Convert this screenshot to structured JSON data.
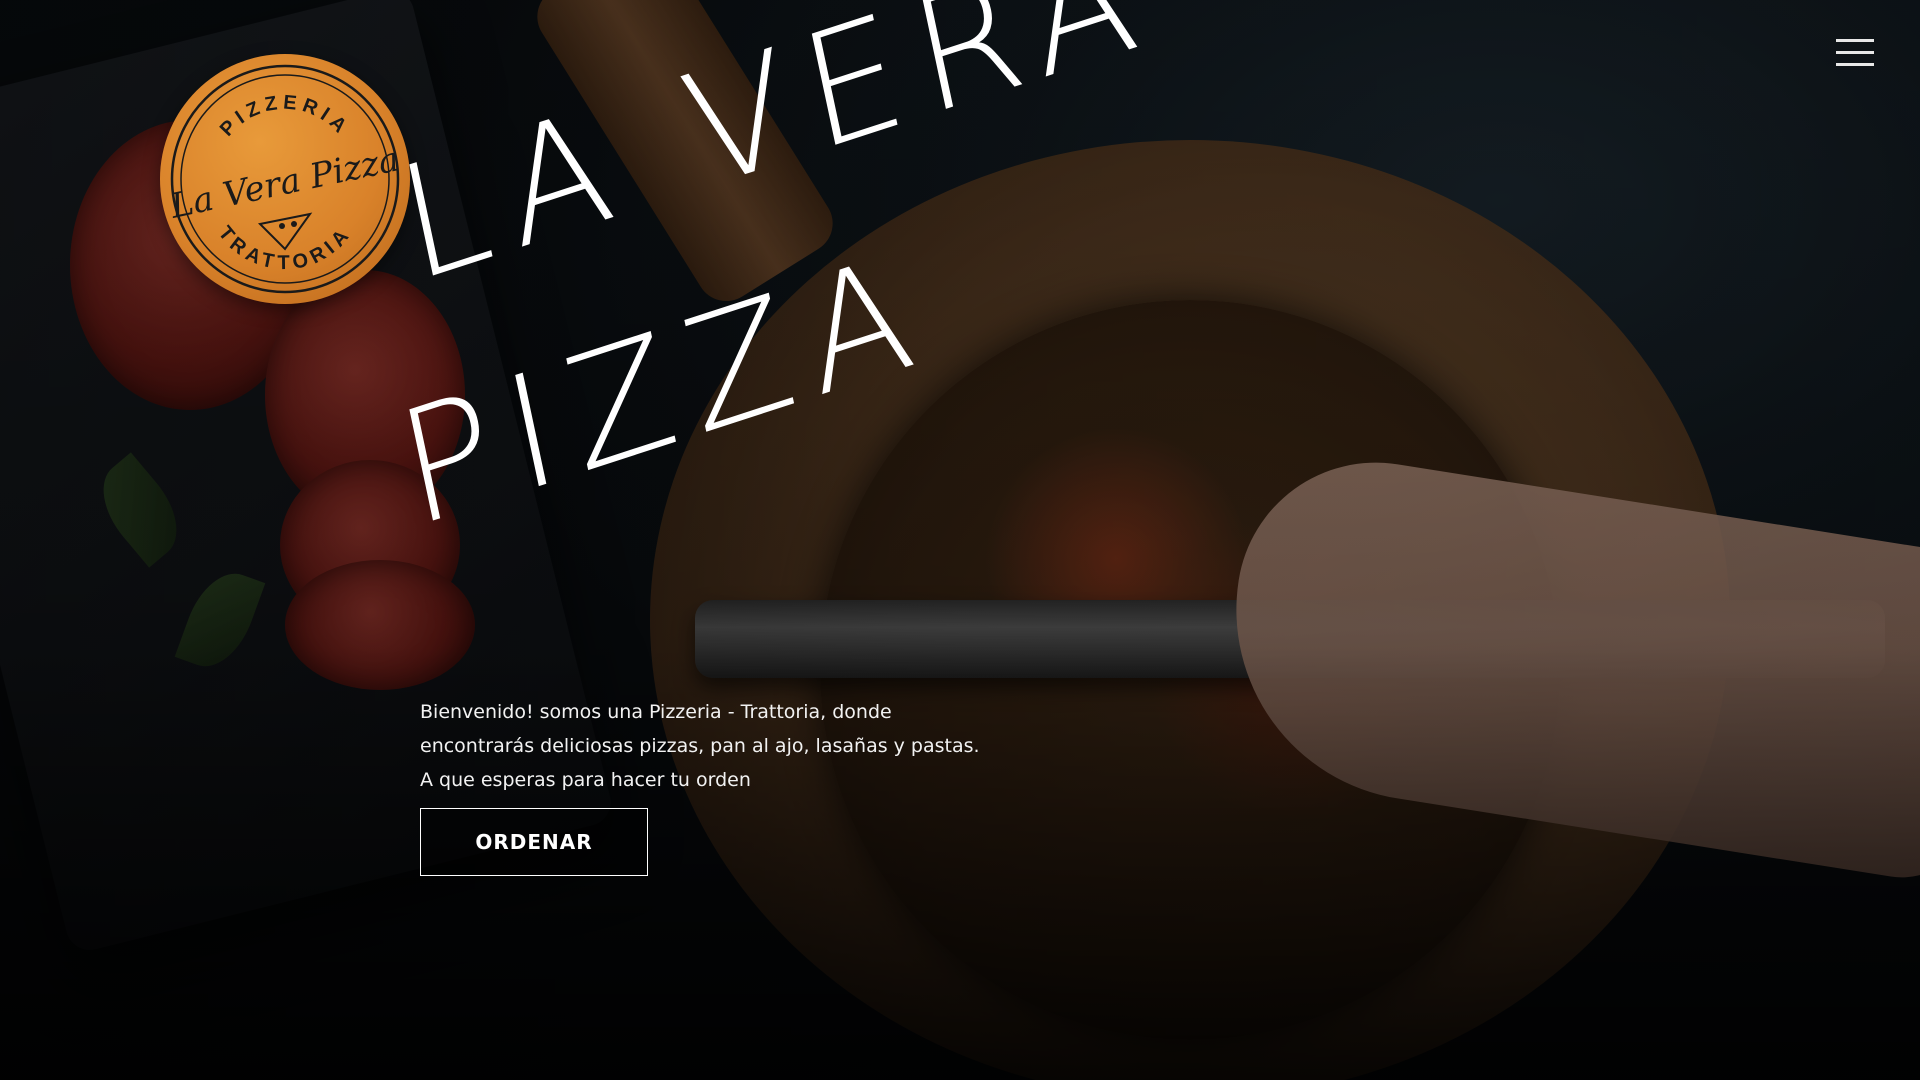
{
  "logo": {
    "top_text": "PIZZERIA",
    "script_text": "La Vera Pizza",
    "bottom_text": "TRATTORIA",
    "color": "#d9822a"
  },
  "header": {
    "menu_icon": "hamburger-menu-icon"
  },
  "hero": {
    "title_line1": "La Vera",
    "title_line2": "Pizza",
    "intro": "Bienvenido! somos una Pizzeria - Trattoria, donde encontrarás deliciosas pizzas, pan al ajo, lasañas y pastas. A que esperas para hacer tu orden",
    "cta_label": "ORDENAR"
  },
  "colors": {
    "background": "#0b0d10",
    "text": "#ffffff",
    "accent": "#d9822a"
  }
}
